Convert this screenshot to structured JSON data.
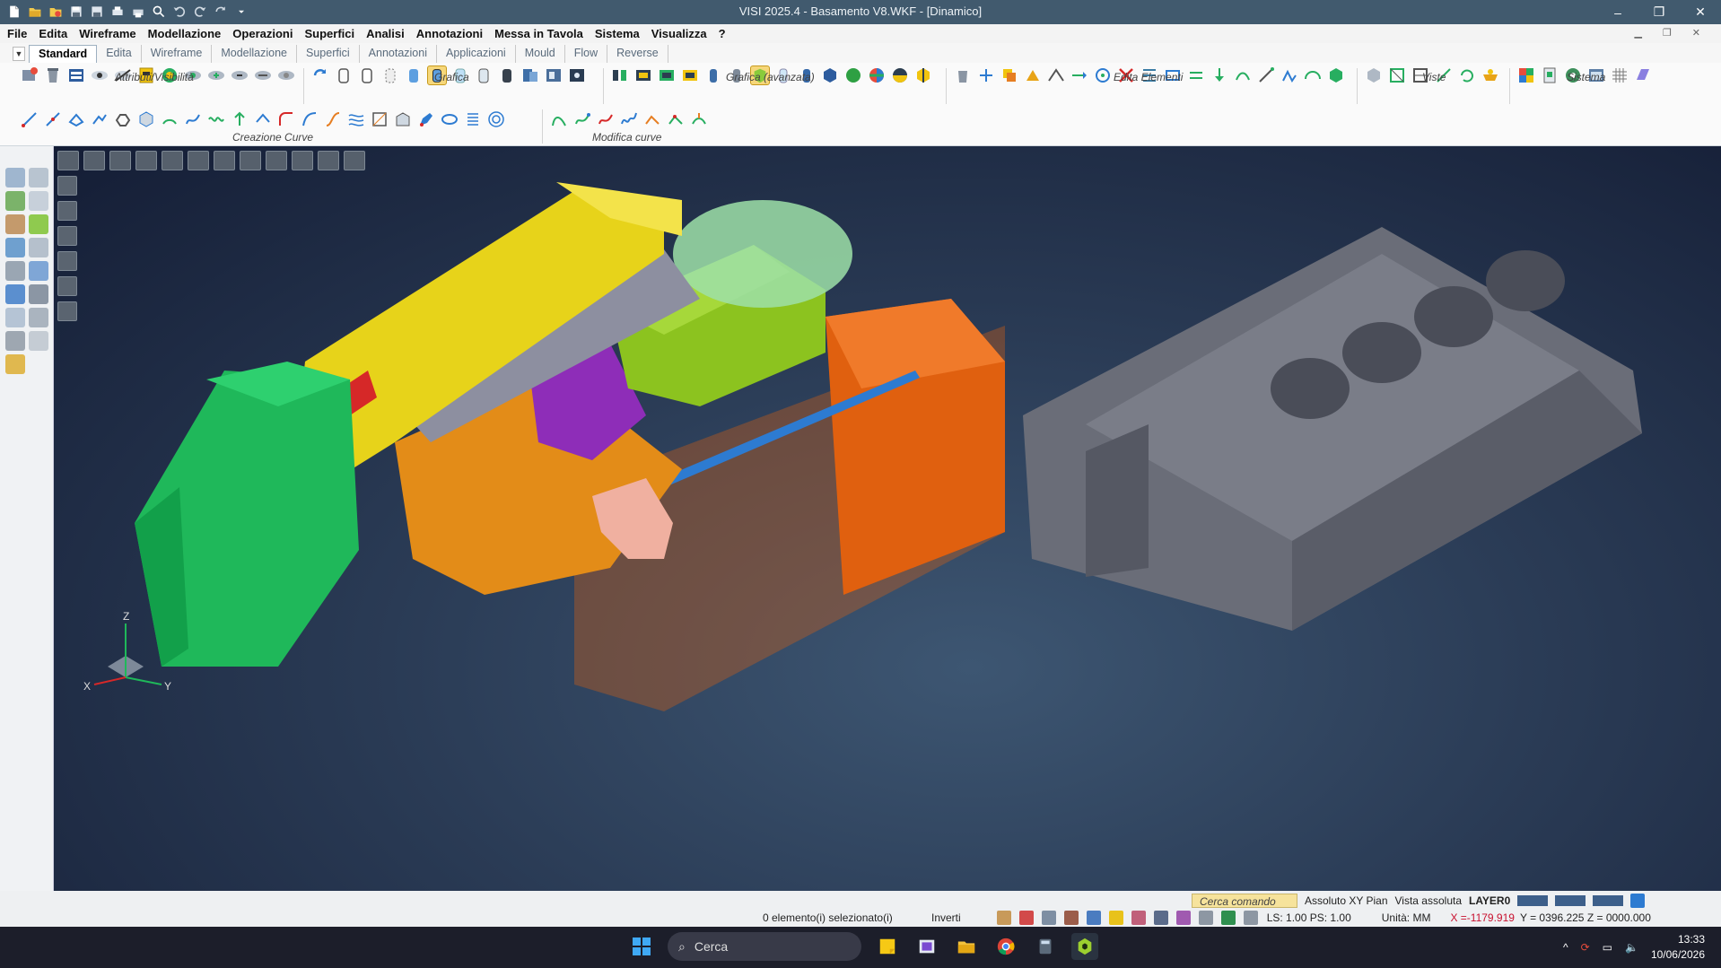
{
  "window": {
    "title": "VISI 2025.4 - Basamento V8.WKF - [Dinamico]",
    "minimize": "–",
    "maximize": "❐",
    "close": "✕"
  },
  "menu": [
    "File",
    "Edita",
    "Wireframe",
    "Modellazione",
    "Operazioni",
    "Superfici",
    "Analisi",
    "Annotazioni",
    "Messa in Tavola",
    "Sistema",
    "Visualizza",
    "?"
  ],
  "tabs": [
    "Standard",
    "Edita",
    "Wireframe",
    "Modellazione",
    "Superfici",
    "Annotazioni",
    "Applicazioni",
    "Mould",
    "Flow",
    "Reverse"
  ],
  "active_tab": "Standard",
  "ribbon_groups": {
    "attributi": "Attributi/Visibilità",
    "grafica": "Grafica",
    "grafica_avanzata": "Grafica (avanzata)",
    "edita_elementi": "Edita Elementi",
    "viste": "Viste",
    "sistema": "Sistema",
    "creazione_curve": "Creazione Curve",
    "modifica_curve": "Modifica curve"
  },
  "triad": {
    "x": "X",
    "y": "Y",
    "z": "Z"
  },
  "status": {
    "search_placeholder": "Cerca comando",
    "plane": "Assoluto XY Pian",
    "view": "Vista assoluta",
    "layer": "LAYER0",
    "selection": "0 elemento(i) selezionato(i)",
    "invert": "Inverti",
    "ls_ps": "LS: 1.00 PS: 1.00",
    "units": "Unità: MM",
    "x_coord": "X =-1179.919",
    "yz_coords": "Y = 0396.225 Z = 0000.000"
  },
  "taskbar": {
    "search_label": "Cerca",
    "time": "13:33",
    "date": "10/06/2026"
  },
  "colors": {
    "title_bar": "#415a6e",
    "viewport_bg": "#2a3b55",
    "mould_green": "#1fb85a",
    "mould_yellow": "#e7d31a",
    "mould_orange": "#e0600f",
    "mould_lime": "#8cc31f",
    "block_gray": "#6a6d78",
    "coord_red": "#c8102e"
  }
}
